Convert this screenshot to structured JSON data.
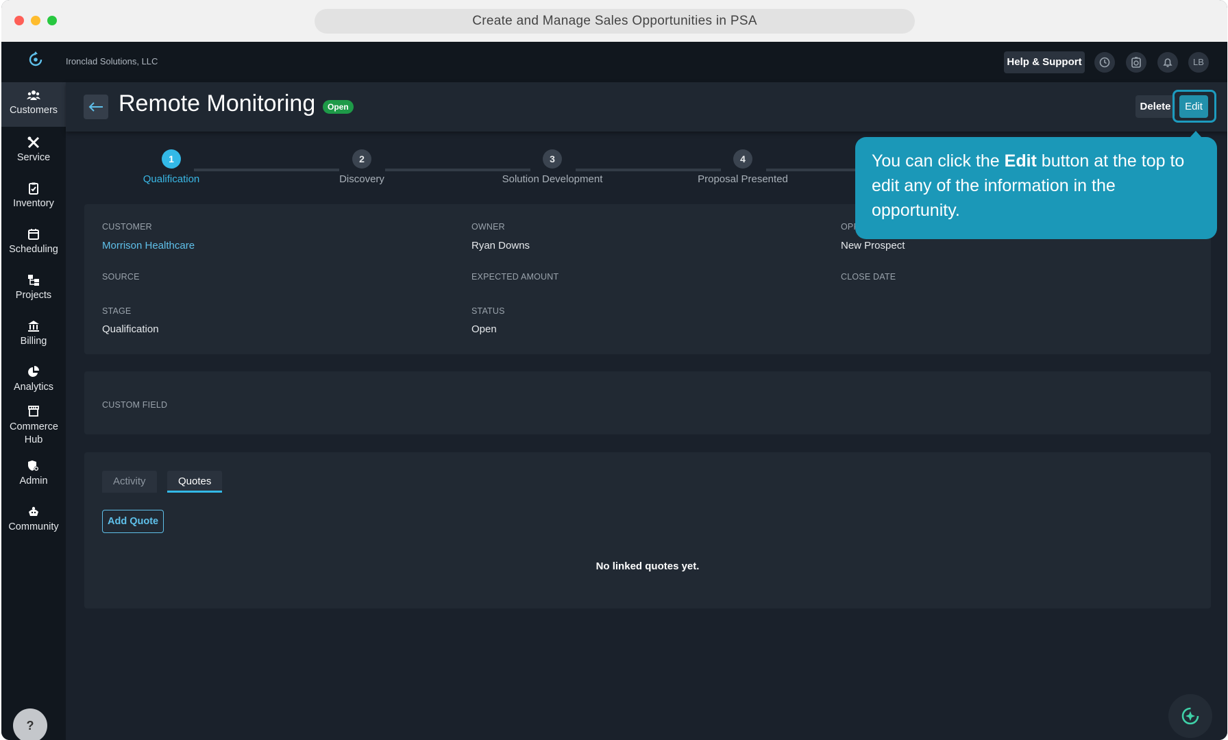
{
  "browser": {
    "url_title": "Create and Manage Sales Opportunities in PSA"
  },
  "topbar": {
    "company": "Ironclad Solutions, LLC",
    "help_label": "Help & Support",
    "avatar_initials": "LB"
  },
  "sidebar": {
    "items": [
      {
        "label": "Customers",
        "icon": "customers-icon"
      },
      {
        "label": "Service",
        "icon": "service-icon"
      },
      {
        "label": "Inventory",
        "icon": "inventory-icon"
      },
      {
        "label": "Scheduling",
        "icon": "calendar-icon"
      },
      {
        "label": "Projects",
        "icon": "projects-icon"
      },
      {
        "label": "Billing",
        "icon": "bank-icon"
      },
      {
        "label": "Analytics",
        "icon": "pie-chart-icon"
      },
      {
        "label": "Commerce Hub",
        "icon": "store-icon"
      },
      {
        "label": "Admin",
        "icon": "admin-shield-icon"
      },
      {
        "label": "Community",
        "icon": "community-icon"
      }
    ],
    "help_label": "?"
  },
  "header": {
    "title": "Remote Monitoring",
    "status_badge": "Open",
    "delete_label": "Delete",
    "edit_label": "Edit"
  },
  "stepper": {
    "steps": [
      {
        "number": "1",
        "label": "Qualification"
      },
      {
        "number": "2",
        "label": "Discovery"
      },
      {
        "number": "3",
        "label": "Solution Development"
      },
      {
        "number": "4",
        "label": "Proposal Presented"
      }
    ],
    "active_step": 1
  },
  "details": {
    "customer_label": "CUSTOMER",
    "customer_value": "Morrison Healthcare",
    "owner_label": "OWNER",
    "owner_value": "Ryan Downs",
    "opportunity_type_label_partial": "OPP",
    "opportunity_type_value": "New Prospect",
    "source_label": "SOURCE",
    "expected_amount_label": "EXPECTED AMOUNT",
    "close_date_label": "CLOSE DATE",
    "stage_label": "STAGE",
    "stage_value": "Qualification",
    "status_label": "STATUS",
    "status_value": "Open"
  },
  "custom_field": {
    "label": "CUSTOM FIELD"
  },
  "tabs": {
    "activity_label": "Activity",
    "quotes_label": "Quotes",
    "active": "Quotes",
    "add_quote_label": "Add Quote",
    "empty_message": "No linked quotes yet."
  },
  "tooltip": {
    "before": "You can click the ",
    "bold": "Edit",
    "after": " button at the top to edit any of the information in the opportunity."
  },
  "colors": {
    "accent": "#33b9e8",
    "tooltip_bg": "#1b98b8",
    "badge_green": "#1e9a48",
    "background": "#1a212b"
  }
}
